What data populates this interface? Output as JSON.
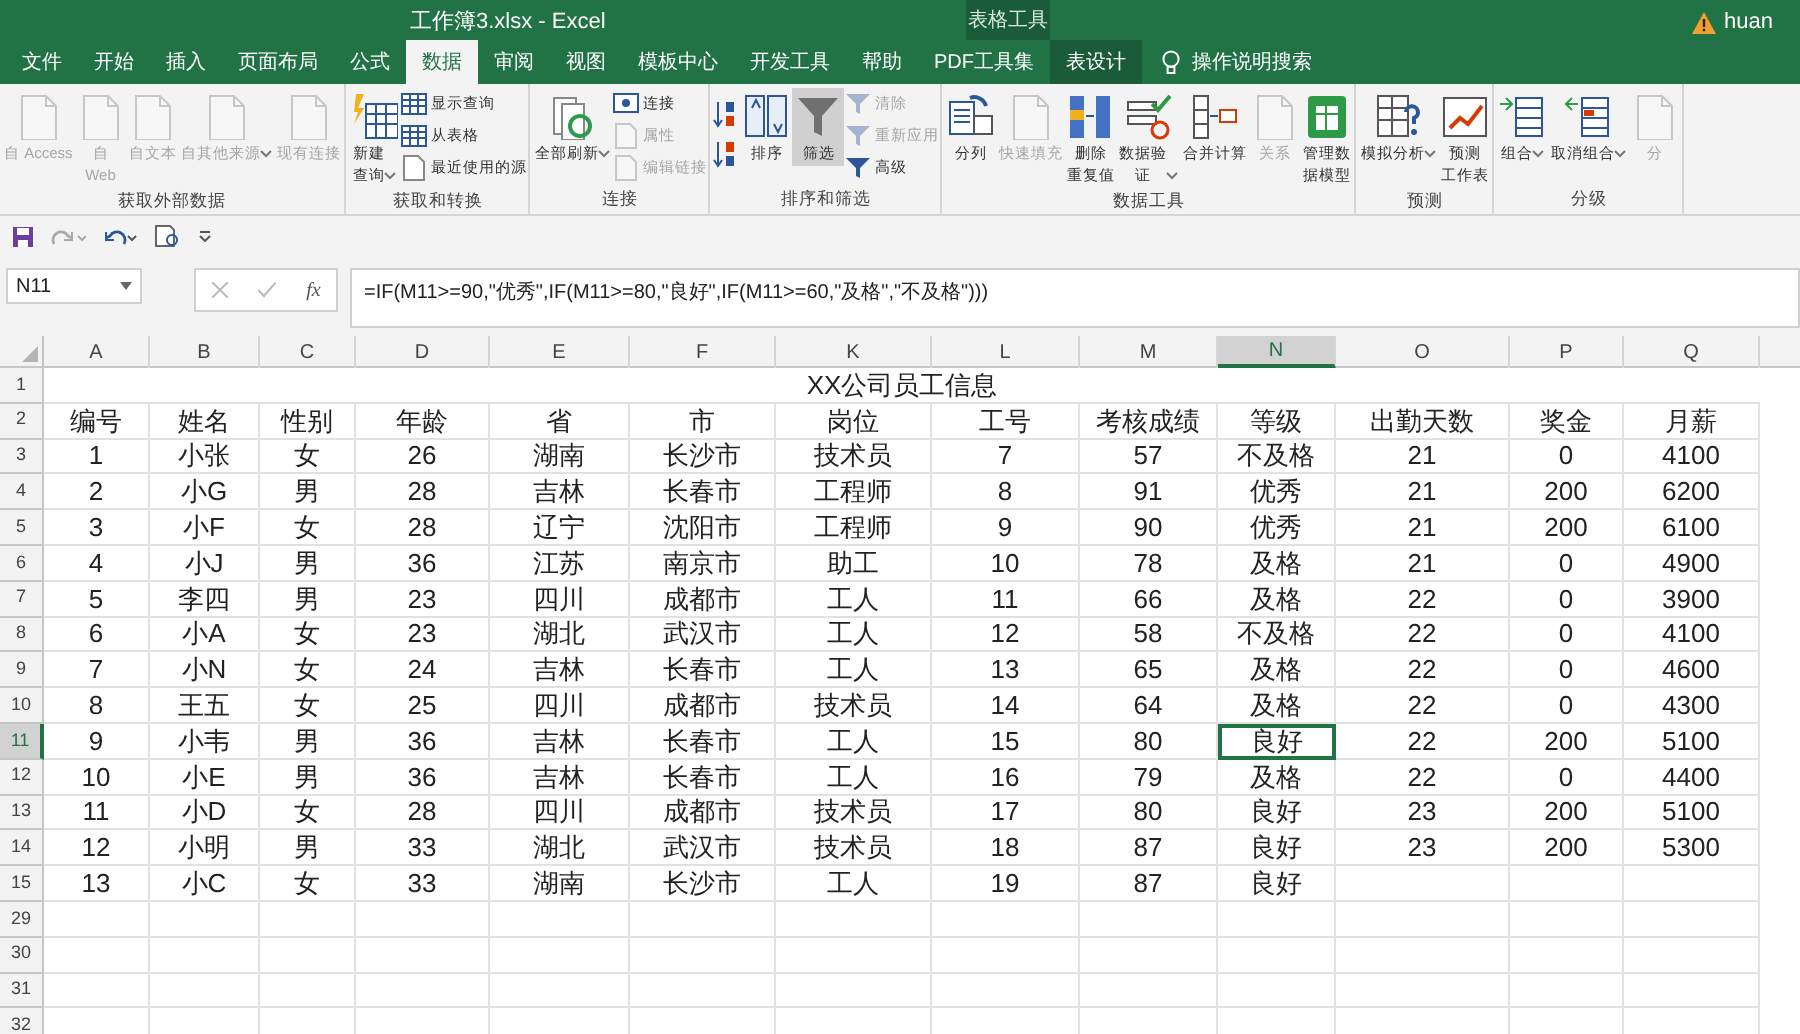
{
  "window": {
    "title": "工作簿3.xlsx  -  Excel",
    "context_group": "表格工具",
    "user": "huan"
  },
  "tabs": [
    {
      "label": "文件",
      "selected": false
    },
    {
      "label": "开始",
      "selected": false
    },
    {
      "label": "插入",
      "selected": false
    },
    {
      "label": "页面布局",
      "selected": false
    },
    {
      "label": "公式",
      "selected": false
    },
    {
      "label": "数据",
      "selected": true
    },
    {
      "label": "审阅",
      "selected": false
    },
    {
      "label": "视图",
      "selected": false
    },
    {
      "label": "模板中心",
      "selected": false
    },
    {
      "label": "开发工具",
      "selected": false
    },
    {
      "label": "帮助",
      "selected": false
    },
    {
      "label": "PDF工具集",
      "selected": false
    },
    {
      "label": "表设计",
      "selected": false,
      "kind": "context"
    }
  ],
  "tell_me": "操作说明搜索",
  "ribbon_groups": [
    {
      "name": "获取外部数据",
      "buttons": [
        {
          "label": [
            "自 Access"
          ],
          "kind": "large",
          "disabled": true
        },
        {
          "label": [
            "自",
            "Web"
          ],
          "kind": "large",
          "disabled": true
        },
        {
          "label": [
            "自文本"
          ],
          "kind": "large",
          "disabled": true
        },
        {
          "label": [
            "自其他来源"
          ],
          "kind": "large",
          "disabled": true,
          "dropdown": true
        },
        {
          "label": [
            "现有连接"
          ],
          "kind": "large",
          "disabled": true
        }
      ]
    },
    {
      "name": "获取和转换",
      "buttons": [
        {
          "label": [
            "新建",
            "查询"
          ],
          "kind": "large",
          "disabled": false,
          "dropdown": true
        },
        {
          "label": [
            "显示查询"
          ],
          "kind": "small",
          "disabled": false
        },
        {
          "label": [
            "从表格"
          ],
          "kind": "small",
          "disabled": false
        },
        {
          "label": [
            "最近使用的源"
          ],
          "kind": "small",
          "disabled": false
        }
      ]
    },
    {
      "name": "连接",
      "buttons": [
        {
          "label": [
            "全部刷新"
          ],
          "kind": "large",
          "disabled": false,
          "dropdown": true
        },
        {
          "label": [
            "连接"
          ],
          "kind": "small",
          "disabled": false
        },
        {
          "label": [
            "属性"
          ],
          "kind": "small",
          "disabled": true
        },
        {
          "label": [
            "编辑链接"
          ],
          "kind": "small",
          "disabled": true
        }
      ]
    },
    {
      "name": "排序和筛选",
      "buttons": [
        {
          "label": [
            "排序"
          ],
          "kind": "large",
          "disabled": false
        },
        {
          "label": [
            "筛选"
          ],
          "kind": "large",
          "disabled": false,
          "pressed": true
        },
        {
          "label": [
            "清除"
          ],
          "kind": "small",
          "disabled": true
        },
        {
          "label": [
            "重新应用"
          ],
          "kind": "small",
          "disabled": true
        },
        {
          "label": [
            "高级"
          ],
          "kind": "small",
          "disabled": false
        }
      ]
    },
    {
      "name": "数据工具",
      "buttons": [
        {
          "label": [
            "分列"
          ],
          "kind": "large",
          "disabled": false
        },
        {
          "label": [
            "快速填充"
          ],
          "kind": "large",
          "disabled": true
        },
        {
          "label": [
            "删除",
            "重复值"
          ],
          "kind": "large",
          "disabled": false
        },
        {
          "label": [
            "数据验",
            "证"
          ],
          "kind": "large",
          "disabled": false,
          "dropdown": true
        },
        {
          "label": [
            "合并计算"
          ],
          "kind": "large",
          "disabled": false
        },
        {
          "label": [
            "关系"
          ],
          "kind": "large",
          "disabled": true
        },
        {
          "label": [
            "管理数",
            "据模型"
          ],
          "kind": "large",
          "disabled": false
        }
      ]
    },
    {
      "name": "预测",
      "buttons": [
        {
          "label": [
            "模拟分析"
          ],
          "kind": "large",
          "disabled": false,
          "dropdown": true
        },
        {
          "label": [
            "预测",
            "工作表"
          ],
          "kind": "large",
          "disabled": false
        }
      ]
    },
    {
      "name": "分级",
      "buttons": [
        {
          "label": [
            "组合"
          ],
          "kind": "large",
          "disabled": false,
          "dropdown": true
        },
        {
          "label": [
            "取消组合"
          ],
          "kind": "large",
          "disabled": false,
          "dropdown": true
        },
        {
          "label": [
            "分"
          ],
          "kind": "large",
          "disabled": true
        }
      ]
    }
  ],
  "name_box": "N11",
  "fx": "fx",
  "formula": "=IF(M11>=90,\"优秀\",IF(M11>=80,\"良好\",IF(M11>=60,\"及格\",\"不及格\")))",
  "columns": [
    {
      "label": "A",
      "selected": false
    },
    {
      "label": "B",
      "selected": false
    },
    {
      "label": "C",
      "selected": false
    },
    {
      "label": "D",
      "selected": false
    },
    {
      "label": "E",
      "selected": false
    },
    {
      "label": "F",
      "selected": false
    },
    {
      "label": "K",
      "selected": false
    },
    {
      "label": "L",
      "selected": false
    },
    {
      "label": "M",
      "selected": false
    },
    {
      "label": "N",
      "selected": true
    },
    {
      "label": "O",
      "selected": false
    },
    {
      "label": "P",
      "selected": false
    },
    {
      "label": "Q",
      "selected": false
    }
  ],
  "rows": [
    {
      "label": "1",
      "selected": false,
      "title": "XX公司员工信息"
    },
    {
      "label": "2",
      "selected": false,
      "cells": [
        "编号",
        "姓名",
        "性别",
        "年龄",
        "省",
        "市",
        "岗位",
        "工号",
        "考核成绩",
        "等级",
        "出勤天数",
        "奖金",
        "月薪"
      ]
    },
    {
      "label": "3",
      "selected": false,
      "cells": [
        "1",
        "小张",
        "女",
        "26",
        "湖南",
        "长沙市",
        "技术员",
        "7",
        "57",
        "不及格",
        "21",
        "0",
        "4100"
      ]
    },
    {
      "label": "4",
      "selected": false,
      "cells": [
        "2",
        "小G",
        "男",
        "28",
        "吉林",
        "长春市",
        "工程师",
        "8",
        "91",
        "优秀",
        "21",
        "200",
        "6200"
      ]
    },
    {
      "label": "5",
      "selected": false,
      "cells": [
        "3",
        "小F",
        "女",
        "28",
        "辽宁",
        "沈阳市",
        "工程师",
        "9",
        "90",
        "优秀",
        "21",
        "200",
        "6100"
      ]
    },
    {
      "label": "6",
      "selected": false,
      "cells": [
        "4",
        "小J",
        "男",
        "36",
        "江苏",
        "南京市",
        "助工",
        "10",
        "78",
        "及格",
        "21",
        "0",
        "4900"
      ]
    },
    {
      "label": "7",
      "selected": false,
      "cells": [
        "5",
        "李四",
        "男",
        "23",
        "四川",
        "成都市",
        "工人",
        "11",
        "66",
        "及格",
        "22",
        "0",
        "3900"
      ]
    },
    {
      "label": "8",
      "selected": false,
      "cells": [
        "6",
        "小A",
        "女",
        "23",
        "湖北",
        "武汉市",
        "工人",
        "12",
        "58",
        "不及格",
        "22",
        "0",
        "4100"
      ]
    },
    {
      "label": "9",
      "selected": false,
      "cells": [
        "7",
        "小N",
        "女",
        "24",
        "吉林",
        "长春市",
        "工人",
        "13",
        "65",
        "及格",
        "22",
        "0",
        "4600"
      ]
    },
    {
      "label": "10",
      "selected": false,
      "cells": [
        "8",
        "王五",
        "女",
        "25",
        "四川",
        "成都市",
        "技术员",
        "14",
        "64",
        "及格",
        "22",
        "0",
        "4300"
      ]
    },
    {
      "label": "11",
      "selected": true,
      "cells": [
        "9",
        "小韦",
        "男",
        "36",
        "吉林",
        "长春市",
        "工人",
        "15",
        "80",
        "良好",
        "22",
        "200",
        "5100"
      ]
    },
    {
      "label": "12",
      "selected": false,
      "cells": [
        "10",
        "小E",
        "男",
        "36",
        "吉林",
        "长春市",
        "工人",
        "16",
        "79",
        "及格",
        "22",
        "0",
        "4400"
      ]
    },
    {
      "label": "13",
      "selected": false,
      "cells": [
        "11",
        "小D",
        "女",
        "28",
        "四川",
        "成都市",
        "技术员",
        "17",
        "80",
        "良好",
        "23",
        "200",
        "5100"
      ]
    },
    {
      "label": "14",
      "selected": false,
      "cells": [
        "12",
        "小明",
        "男",
        "33",
        "湖北",
        "武汉市",
        "技术员",
        "18",
        "87",
        "良好",
        "23",
        "200",
        "5300"
      ]
    },
    {
      "label": "15",
      "selected": false,
      "cells": [
        "13",
        "小C",
        "女",
        "33",
        "湖南",
        "长沙市",
        "工人",
        "19",
        "87",
        "良好"
      ]
    },
    {
      "label": "29",
      "selected": false
    },
    {
      "label": "30",
      "selected": false
    },
    {
      "label": "31",
      "selected": false
    },
    {
      "label": "32",
      "selected": false
    }
  ]
}
